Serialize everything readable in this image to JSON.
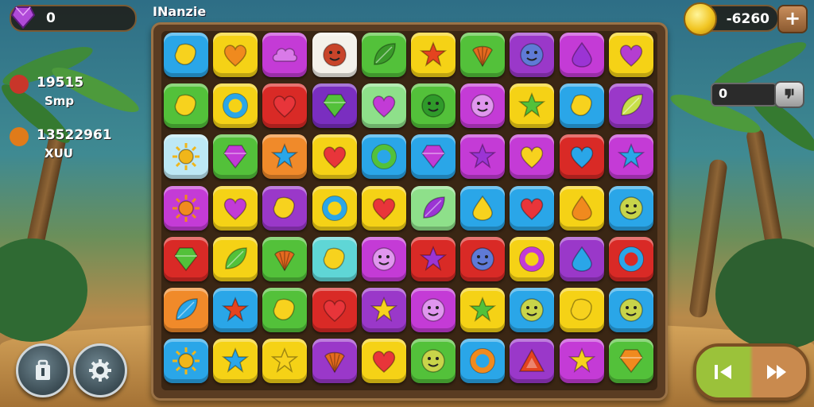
{
  "hud": {
    "gems": "0",
    "title": "INanzie",
    "coins": "-6260",
    "plus_label": "+"
  },
  "stats": [
    {
      "value": "19515",
      "label": "Smp",
      "color": "#c8362a"
    },
    {
      "value": "13522961",
      "label": "XUU",
      "color": "#e07b1a"
    }
  ],
  "right_widget": {
    "value": "0"
  },
  "board": {
    "rows": [
      [
        {
          "c": "#2aa6e8",
          "s": "blob",
          "f": "#f7d21e"
        },
        {
          "c": "#f5d216",
          "s": "heart",
          "f": "#f08a1e"
        },
        {
          "c": "#c43bd6",
          "s": "cloud",
          "f": "#d97ae8"
        },
        {
          "c": "#f4f1ea",
          "s": "face",
          "f": "#c8442a"
        },
        {
          "c": "#53c13a",
          "s": "leaf",
          "f": "#3a9a2a"
        },
        {
          "c": "#f5d216",
          "s": "star",
          "f": "#e4441f"
        },
        {
          "c": "#53c13a",
          "s": "shell",
          "f": "#e56a1f"
        },
        {
          "c": "#9a38c9",
          "s": "face",
          "f": "#5f7ad6"
        },
        {
          "c": "#c43bd6",
          "s": "drop",
          "f": "#9b34d4"
        },
        {
          "c": "#f5d216",
          "s": "heart",
          "f": "#b43ed0"
        }
      ],
      [
        {
          "c": "#53c13a",
          "s": "blob",
          "f": "#f7d21e"
        },
        {
          "c": "#f5d216",
          "s": "ring",
          "f": "#2aa6e8"
        },
        {
          "c": "#d92a26",
          "s": "heart",
          "f": "#e8353a"
        },
        {
          "c": "#7a2ec0",
          "s": "gem",
          "f": "#53c13a"
        },
        {
          "c": "#8ee08a",
          "s": "heart",
          "f": "#c23bd6"
        },
        {
          "c": "#53c13a",
          "s": "face",
          "f": "#2f9a2a"
        },
        {
          "c": "#c43bd6",
          "s": "face",
          "f": "#e096ee"
        },
        {
          "c": "#f5d216",
          "s": "star",
          "f": "#53c13a"
        },
        {
          "c": "#2aa6e8",
          "s": "blob",
          "f": "#f7d21e"
        },
        {
          "c": "#9a38c9",
          "s": "leaf",
          "f": "#c8e04a"
        }
      ],
      [
        {
          "c": "#bde8f5",
          "s": "sun",
          "f": "#f0b61a"
        },
        {
          "c": "#53c13a",
          "s": "gem",
          "f": "#c23bd6"
        },
        {
          "c": "#f08a2a",
          "s": "star",
          "f": "#2aa6e8"
        },
        {
          "c": "#f5d216",
          "s": "heart",
          "f": "#e8353a"
        },
        {
          "c": "#2aa6e8",
          "s": "ring",
          "f": "#53c13a"
        },
        {
          "c": "#2aa6e8",
          "s": "gem",
          "f": "#c23bd6"
        },
        {
          "c": "#c43bd6",
          "s": "star",
          "f": "#9b34d4"
        },
        {
          "c": "#c43bd6",
          "s": "heart",
          "f": "#f7d21e"
        },
        {
          "c": "#d92a26",
          "s": "heart",
          "f": "#2aa6e8"
        },
        {
          "c": "#c43bd6",
          "s": "star",
          "f": "#2aa6e8"
        }
      ],
      [
        {
          "c": "#c43bd6",
          "s": "sun",
          "f": "#f08a1e"
        },
        {
          "c": "#f5d216",
          "s": "heart",
          "f": "#c23bd6"
        },
        {
          "c": "#9a38c9",
          "s": "blob",
          "f": "#f7d21e"
        },
        {
          "c": "#f5d216",
          "s": "ring",
          "f": "#2aa6e8"
        },
        {
          "c": "#f5d216",
          "s": "heart",
          "f": "#e8353a"
        },
        {
          "c": "#8ee08a",
          "s": "leaf",
          "f": "#9b34d4"
        },
        {
          "c": "#2aa6e8",
          "s": "drop",
          "f": "#f7d21e"
        },
        {
          "c": "#2aa6e8",
          "s": "heart",
          "f": "#e8353a"
        },
        {
          "c": "#f5d216",
          "s": "drop",
          "f": "#f08a1e"
        },
        {
          "c": "#2aa6e8",
          "s": "face",
          "f": "#c8d44a"
        }
      ],
      [
        {
          "c": "#d92a26",
          "s": "gem",
          "f": "#53c13a"
        },
        {
          "c": "#f5d216",
          "s": "leaf",
          "f": "#53c13a"
        },
        {
          "c": "#53c13a",
          "s": "shell",
          "f": "#e56a1f"
        },
        {
          "c": "#5fd6d6",
          "s": "blob",
          "f": "#f7d21e"
        },
        {
          "c": "#c43bd6",
          "s": "face",
          "f": "#e096ee"
        },
        {
          "c": "#d92a26",
          "s": "star",
          "f": "#9b34d4"
        },
        {
          "c": "#d92a26",
          "s": "face",
          "f": "#5f7ad6"
        },
        {
          "c": "#f5d216",
          "s": "ring",
          "f": "#c23bd6"
        },
        {
          "c": "#9a38c9",
          "s": "drop",
          "f": "#2aa6e8"
        },
        {
          "c": "#d92a26",
          "s": "ring",
          "f": "#2aa6e8"
        }
      ],
      [
        {
          "c": "#f08a2a",
          "s": "leaf",
          "f": "#2aa6e8"
        },
        {
          "c": "#2aa6e8",
          "s": "star",
          "f": "#e4441f"
        },
        {
          "c": "#53c13a",
          "s": "blob",
          "f": "#f7d21e"
        },
        {
          "c": "#d92a26",
          "s": "heart",
          "f": "#e8353a"
        },
        {
          "c": "#9a38c9",
          "s": "star",
          "f": "#f7d21e"
        },
        {
          "c": "#c43bd6",
          "s": "face",
          "f": "#e096ee"
        },
        {
          "c": "#f5d216",
          "s": "star",
          "f": "#53c13a"
        },
        {
          "c": "#2aa6e8",
          "s": "face",
          "f": "#c8d44a"
        },
        {
          "c": "#f5d216",
          "s": "blob",
          "f": "#f7d21e"
        },
        {
          "c": "#2aa6e8",
          "s": "face",
          "f": "#c8d44a"
        }
      ],
      [
        {
          "c": "#2aa6e8",
          "s": "sun",
          "f": "#f0b61a"
        },
        {
          "c": "#f5d216",
          "s": "star",
          "f": "#2aa6e8"
        },
        {
          "c": "#f5d216",
          "s": "star",
          "f": "#f7d21e"
        },
        {
          "c": "#9a38c9",
          "s": "shell",
          "f": "#e56a1f"
        },
        {
          "c": "#f5d216",
          "s": "heart",
          "f": "#e8353a"
        },
        {
          "c": "#53c13a",
          "s": "face",
          "f": "#c8d44a"
        },
        {
          "c": "#2aa6e8",
          "s": "ring",
          "f": "#f08a1e"
        },
        {
          "c": "#9a38c9",
          "s": "tri",
          "f": "#e4441f"
        },
        {
          "c": "#c43bd6",
          "s": "star",
          "f": "#f7d21e"
        },
        {
          "c": "#53c13a",
          "s": "gem",
          "f": "#f08a1e"
        }
      ]
    ]
  }
}
